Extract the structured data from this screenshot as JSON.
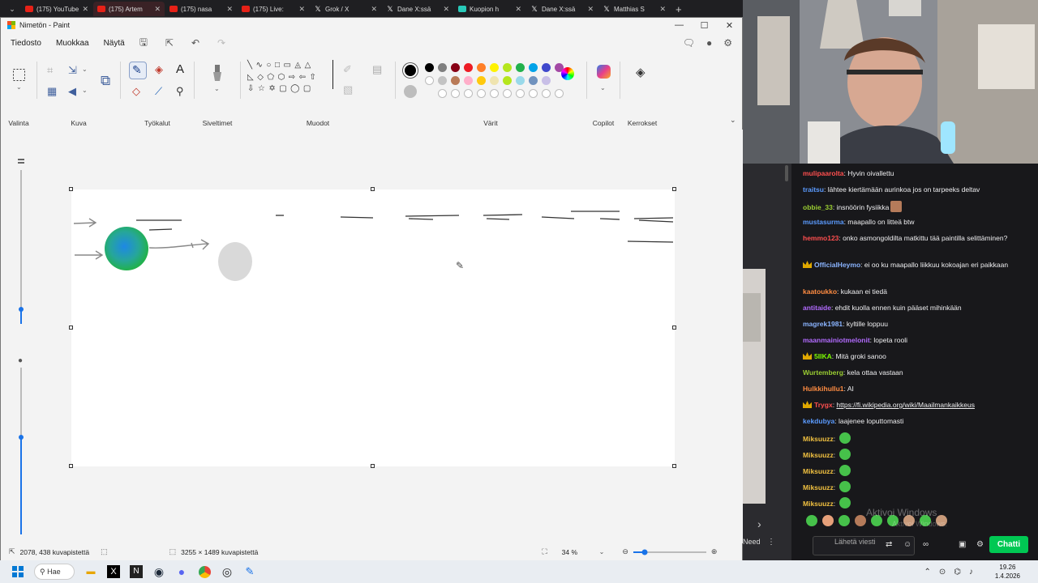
{
  "browser": {
    "tabs": [
      {
        "icon": "youtube-icon",
        "label": "(175) YouTube",
        "active": false
      },
      {
        "icon": "youtube-icon",
        "label": "(175) Artem",
        "active": true
      },
      {
        "icon": "youtube-icon",
        "label": "(175) nasa",
        "active": false
      },
      {
        "icon": "youtube-icon",
        "label": "(175) Live:",
        "active": false
      },
      {
        "icon": "x-icon",
        "label": "Grok / X",
        "active": false
      },
      {
        "icon": "x-icon",
        "label": "Dane X:ssä",
        "active": false
      },
      {
        "icon": "kick-icon",
        "label": "Kuopion h",
        "active": false
      },
      {
        "icon": "x-icon",
        "label": "Dane X:ssä",
        "active": false
      },
      {
        "icon": "x-icon",
        "label": "Matthias S",
        "active": false
      }
    ],
    "close_glyph": "✕",
    "new_tab_glyph": "+"
  },
  "paint": {
    "window_title": "Nimetön - Paint",
    "menu": {
      "file": "Tiedosto",
      "edit": "Muokkaa",
      "view": "Näytä"
    },
    "ribbon": {
      "selection_label": "Valinta",
      "image_label": "Kuva",
      "tools_label": "Työkalut",
      "brushes_label": "Siveltimet",
      "shapes_label": "Muodot",
      "colors_label": "Värit",
      "copilot_label": "Copilot",
      "layers_label": "Kerrokset"
    },
    "colors": {
      "primary": "#000000",
      "secondary": "#bdbdbd",
      "palette_row1": [
        "#000000",
        "#7f7f7f",
        "#880015",
        "#ed1c24",
        "#ff7f27",
        "#fff200",
        "#b5e61d",
        "#22b14c",
        "#00a2e8",
        "#3f48cc",
        "#a349a4"
      ],
      "palette_row2": [
        "#ffffff",
        "#c3c3c3",
        "#b97a57",
        "#ffaec9",
        "#ffc90e",
        "#efe4b0",
        "#b5e61d",
        "#99d9ea",
        "#7092be",
        "#c8bfe7"
      ],
      "palette_row3_empty": 10
    },
    "status": {
      "cursor_position": "2078, 438 kuvapistettä",
      "image_size": "3255 × 1489 kuvapistettä",
      "zoom": "34 %"
    }
  },
  "chat": {
    "messages": [
      {
        "user": "mulipaarolta",
        "color": "#ff4f4f",
        "text": "Hyvin oivallettu"
      },
      {
        "user": "traitsu",
        "color": "#5b9bff",
        "text": "lähtee kiertämään aurinkoa jos on tarpeeks deltav"
      },
      {
        "user": "obbie_33",
        "color": "#9acd32",
        "text": "insnöörin fysiikka"
      },
      {
        "user": "mustasurma",
        "color": "#5b9bff",
        "text": "maapallo on litteä btw"
      },
      {
        "user": "hemmo123",
        "color": "#ff4f4f",
        "text": "onko asmongoldilta matkittu tää paintilla selittäminen?"
      },
      {
        "user": "OfficialHeymo",
        "color": "#8ab4ff",
        "text": "ei oo ku maapallo liikkuu kokoajan eri paikkaan"
      },
      {
        "user": "kaatoukko",
        "color": "#ff8c42",
        "text": "kukaan ei tiedä"
      },
      {
        "user": "antitaide",
        "color": "#b26bff",
        "text": "ehdit kuolla ennen kuin pääset mihinkään"
      },
      {
        "user": "magrek1981",
        "color": "#8ab4ff",
        "text": "kyltille loppuu"
      },
      {
        "user": "maanmainiotmelonit",
        "color": "#b26bff",
        "text": "lopeta rooli"
      },
      {
        "user": "5IIKA",
        "color": "#7cfc00",
        "text": "Mitä groki sanoo"
      },
      {
        "user": "Wurtemberg",
        "color": "#9acd32",
        "text": "kela ottaa vastaan"
      },
      {
        "user": "Hulkkihullu1",
        "color": "#ff8c42",
        "text": "AI"
      },
      {
        "user": "Trygx",
        "color": "#ff4f4f",
        "text": "https://fi.wikipedia.org/wiki/Maailmankaikkeus"
      },
      {
        "user": "kekdubya",
        "color": "#5b9bff",
        "text": "laajenee loputtomasti"
      },
      {
        "user": "Miksuuzz",
        "color": "#f0c040",
        "text": ""
      },
      {
        "user": "Miksuuzz",
        "color": "#f0c040",
        "text": ""
      },
      {
        "user": "Miksuuzz",
        "color": "#f0c040",
        "text": ""
      },
      {
        "user": "Miksuuzz",
        "color": "#f0c040",
        "text": ""
      },
      {
        "user": "Miksuuzz",
        "color": "#f0c040",
        "text": ""
      }
    ],
    "input_placeholder": "Lähetä viesti",
    "send_label": "Chatti",
    "side_label": "Need"
  },
  "watermark": {
    "title": "Aktivoi Windows",
    "subtitle": "Aktivoi Windows."
  },
  "taskbar": {
    "search_label": "Hae",
    "time": "19.26",
    "date": "1.4.2026"
  }
}
